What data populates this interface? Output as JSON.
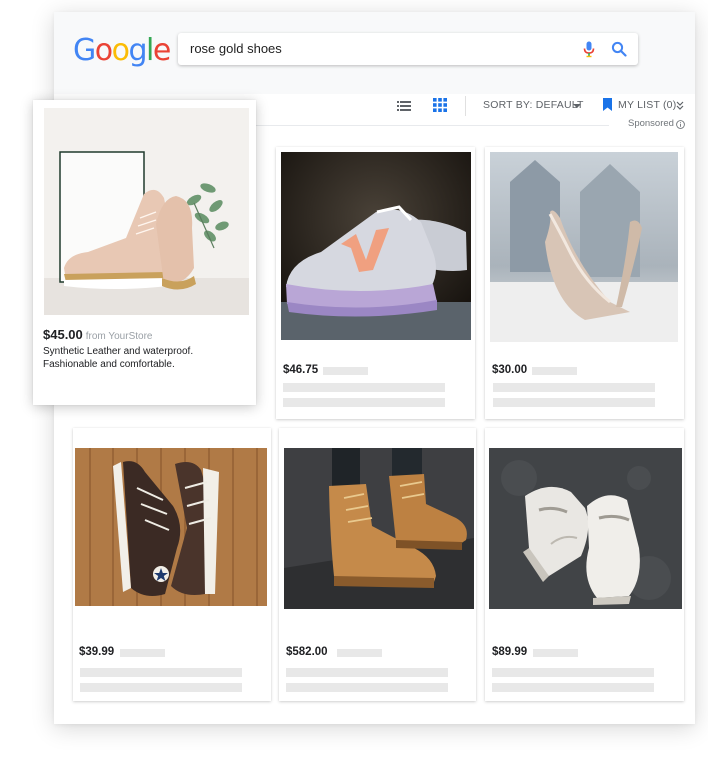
{
  "search": {
    "query": "rose gold shoes"
  },
  "logo": {
    "letters": [
      "G",
      "o",
      "o",
      "g",
      "l",
      "e"
    ],
    "colors": [
      "#4285F4",
      "#EA4335",
      "#FBBC05",
      "#4285F4",
      "#34A853",
      "#EA4335"
    ]
  },
  "toolbar": {
    "sort_label": "SORT BY: DEFAULT",
    "my_list_label": "MY LIST (0)",
    "sponsored_label": "Sponsored"
  },
  "featured": {
    "price": "$45.00",
    "store": "from YourStore",
    "description_line1": "Synthetic Leather and waterproof.",
    "description_line2": "Fashionable and comfortable."
  },
  "products": [
    {
      "price": "$46.75",
      "image": "pastel-running-sneaker"
    },
    {
      "price": "$30.00",
      "image": "glitter-stiletto-heel"
    },
    {
      "price": "$39.99",
      "image": "dark-high-top-canvas-sneakers"
    },
    {
      "price": "$582.00",
      "image": "tan-work-boots"
    },
    {
      "price": "$89.99",
      "image": "white-high-top-sneakers"
    }
  ],
  "colors": {
    "accent_blue": "#1a73e8",
    "mic_blue": "#4285F4",
    "mic_red": "#EA4335",
    "placeholder_gray": "#e8e8e8"
  }
}
